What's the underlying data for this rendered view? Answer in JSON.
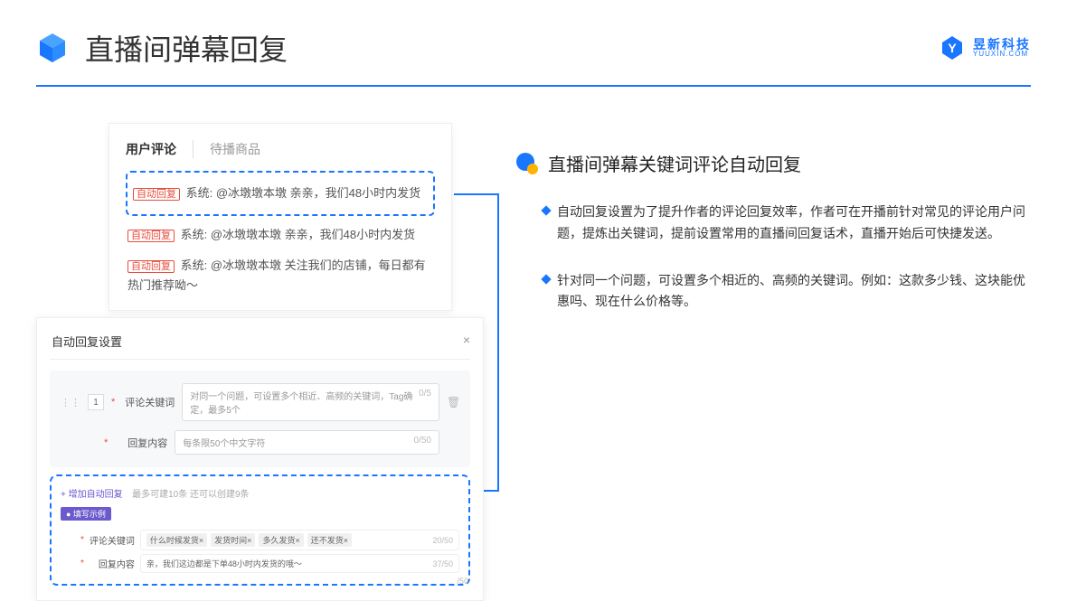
{
  "header": {
    "title": "直播间弹幕回复",
    "brand_cn": "昱新科技",
    "brand_en": "YUUXIN.COM"
  },
  "comments_panel": {
    "tabs": {
      "active": "用户评论",
      "inactive": "待播商品"
    },
    "highlight": {
      "tag": "自动回复",
      "text": "系统: @冰墩墩本墩 亲亲，我们48小时内发货"
    },
    "rows": [
      {
        "tag": "自动回复",
        "text": "系统: @冰墩墩本墩 亲亲，我们48小时内发货"
      },
      {
        "tag": "自动回复",
        "text": "系统: @冰墩墩本墩 关注我们的店铺，每日都有热门推荐呦～"
      }
    ]
  },
  "settings_panel": {
    "title": "自动回复设置",
    "row_num": "1",
    "keyword": {
      "label": "评论关键词",
      "placeholder": "对同一个问题，可设置多个相近、高频的关键词，Tag确定，最多5个",
      "count": "0/5"
    },
    "content": {
      "label": "回复内容",
      "placeholder": "每条限50个中文字符",
      "count": "0/50"
    },
    "add_link": "+ 增加自动回复",
    "add_hint": "最多可建10条 还可以创建9条",
    "example_label": "● 填写示例",
    "ex_keyword": {
      "label": "评论关键词",
      "tags": [
        "什么时候发货×",
        "发货时间×",
        "多久发货×",
        "还不发货×"
      ],
      "count": "20/50"
    },
    "ex_content": {
      "label": "回复内容",
      "text": "亲，我们这边都是下单48小时内发货的哦～",
      "count": "37/50"
    },
    "outer_count": "/50"
  },
  "right": {
    "heading": "直播间弹幕关键词评论自动回复",
    "bullets": [
      "自动回复设置为了提升作者的评论回复效率，作者可在开播前针对常见的评论用户问题，提炼出关键词，提前设置常用的直播间回复话术，直播开始后可快捷发送。",
      "针对同一个问题，可设置多个相近的、高频的关键词。例如：这款多少钱、这块能优惠吗、现在什么价格等。"
    ]
  }
}
